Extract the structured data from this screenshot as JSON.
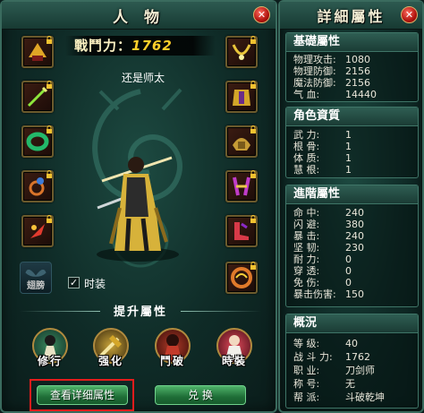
{
  "character_window": {
    "title": "人 物",
    "power_label": "戰鬥力：",
    "power_value": "1762",
    "character_name": "还是师太",
    "wing_slot_label": "翅膀",
    "fashion_checkbox_label": "时装",
    "fashion_checked": true,
    "upgrade_section_title": "提升屬性",
    "upgrade_buttons": [
      {
        "label": "修行",
        "icon": "cultivation-icon"
      },
      {
        "label": "强化",
        "icon": "enhance-icon"
      },
      {
        "label": "鬥破",
        "icon": "break-through-icon"
      },
      {
        "label": "時裝",
        "icon": "fashion-icon"
      }
    ],
    "view_details_button": "查看详细属性",
    "exchange_button": "兑 换",
    "close_symbol": "✕",
    "check_symbol": "✓",
    "equipment_left": [
      {
        "icon": "helmet-icon",
        "color": "#e0a526"
      },
      {
        "icon": "weapon-icon",
        "color": "#8ee63c"
      },
      {
        "icon": "bracelet-icon",
        "color": "#23b86a"
      },
      {
        "icon": "ring-icon",
        "color": "#d8742a"
      },
      {
        "icon": "talisman-icon",
        "color": "#e23b2f"
      }
    ],
    "equipment_right": [
      {
        "icon": "necklace-icon",
        "color": "#e8c43a"
      },
      {
        "icon": "armor-icon",
        "color": "#d4a629"
      },
      {
        "icon": "shoulder-icon",
        "color": "#c69b35"
      },
      {
        "icon": "belt-icon",
        "color": "#c03cc8"
      },
      {
        "icon": "boots-icon",
        "color": "#d83a48"
      },
      {
        "icon": "mount-icon",
        "color": "#e07a2a"
      }
    ]
  },
  "detail_window": {
    "title": "詳細屬性",
    "close_symbol": "✕",
    "sections": [
      {
        "title": "基礎屬性",
        "rows": [
          {
            "key": "物理攻击:",
            "value": "1080"
          },
          {
            "key": "物理防御:",
            "value": "2156"
          },
          {
            "key": "魔法防御:",
            "value": "2156"
          },
          {
            "key": "气    血:",
            "value": "14440"
          }
        ]
      },
      {
        "title": "角色資質",
        "rows": [
          {
            "key": "武    力:",
            "value": "1"
          },
          {
            "key": "根    骨:",
            "value": "1"
          },
          {
            "key": "体    质:",
            "value": "1"
          },
          {
            "key": "慧    根:",
            "value": "1"
          }
        ]
      },
      {
        "title": "進階屬性",
        "rows": [
          {
            "key": "命    中:",
            "value": "240"
          },
          {
            "key": "闪    避:",
            "value": "380"
          },
          {
            "key": "暴    击:",
            "value": "240"
          },
          {
            "key": "坚    韧:",
            "value": "230"
          },
          {
            "key": "耐    力:",
            "value": "0"
          },
          {
            "key": "穿    透:",
            "value": "0"
          },
          {
            "key": "免    伤:",
            "value": "0"
          },
          {
            "key": "暴击伤害:",
            "value": "150"
          }
        ]
      },
      {
        "title": "概況",
        "rows": [
          {
            "key": "等    级:",
            "value": "40"
          },
          {
            "key": "战 斗 力:",
            "value": "1762"
          },
          {
            "key": "职    业:",
            "value": "刀剑师"
          },
          {
            "key": "称    号:",
            "value": "无"
          },
          {
            "key": "帮    派:",
            "value": "斗破乾坤"
          }
        ]
      }
    ]
  }
}
